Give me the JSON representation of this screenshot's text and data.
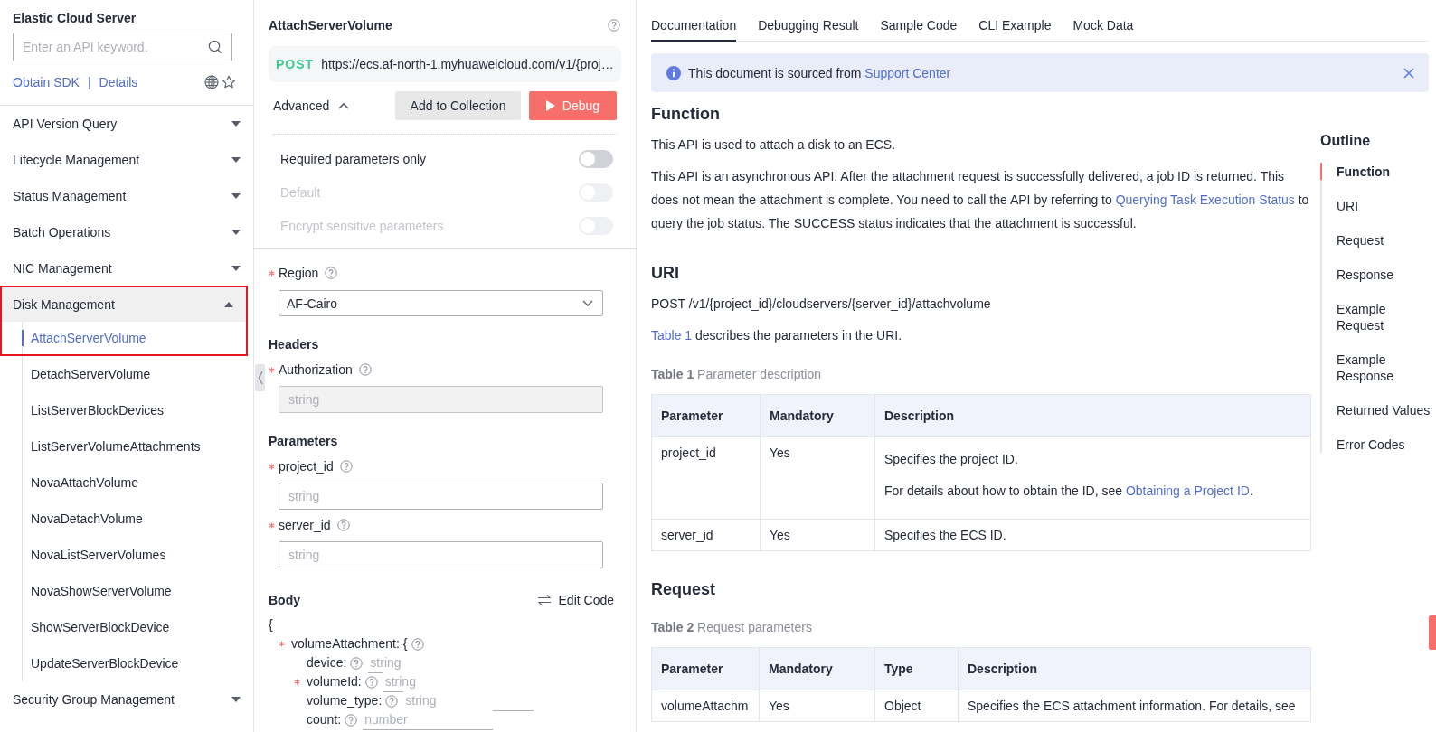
{
  "sidebar": {
    "title": "Elastic Cloud Server",
    "search": {
      "placeholder": "Enter an API keyword."
    },
    "links": [
      {
        "label": "Obtain SDK"
      },
      {
        "label": "Details"
      }
    ],
    "link_separator": "|",
    "groups": [
      {
        "label": "API Version Query",
        "expanded": false,
        "highlighted": false
      },
      {
        "label": "Lifecycle Management",
        "expanded": false,
        "highlighted": false
      },
      {
        "label": "Status Management",
        "expanded": false,
        "highlighted": false
      },
      {
        "label": "Batch Operations",
        "expanded": false,
        "highlighted": false
      },
      {
        "label": "NIC Management",
        "expanded": false,
        "highlighted": false
      },
      {
        "label": "Disk Management",
        "expanded": true,
        "highlighted": true,
        "children": [
          {
            "label": "AttachServerVolume",
            "selected": true
          },
          {
            "label": "DetachServerVolume",
            "selected": false
          },
          {
            "label": "ListServerBlockDevices",
            "selected": false
          },
          {
            "label": "ListServerVolumeAttachments",
            "selected": false
          },
          {
            "label": "NovaAttachVolume",
            "selected": false
          },
          {
            "label": "NovaDetachVolume",
            "selected": false
          },
          {
            "label": "NovaListServerVolumes",
            "selected": false
          },
          {
            "label": "NovaShowServerVolume",
            "selected": false
          },
          {
            "label": "ShowServerBlockDevice",
            "selected": false
          },
          {
            "label": "UpdateServerBlockDevice",
            "selected": false
          }
        ]
      },
      {
        "label": "Security Group Management",
        "expanded": false,
        "highlighted": false
      }
    ]
  },
  "debug_panel": {
    "title": "AttachServerVolume",
    "method": "POST",
    "url": "https://ecs.af-north-1.myhuaweicloud.com/v1/{proj…",
    "advanced": {
      "label": "Advanced",
      "expanded": true
    },
    "actions": [
      {
        "label": "Add to Collection",
        "kind": "secondary"
      },
      {
        "label": "Debug",
        "kind": "primary"
      }
    ],
    "toggles": [
      {
        "label": "Required parameters only",
        "on": false,
        "disabled": false
      },
      {
        "label": "Default",
        "on": false,
        "disabled": true
      },
      {
        "label": "Encrypt sensitive parameters",
        "on": false,
        "disabled": true
      }
    ],
    "region": {
      "label": "Region",
      "required": true,
      "value": "AF-Cairo"
    },
    "sections": [
      {
        "heading": "Headers",
        "fields": [
          {
            "label": "Authorization",
            "required": true,
            "placeholder": "string",
            "disabled": true
          }
        ]
      },
      {
        "heading": "Parameters",
        "fields": [
          {
            "label": "project_id",
            "required": true,
            "placeholder": "string",
            "disabled": false
          },
          {
            "label": "server_id",
            "required": true,
            "placeholder": "string",
            "disabled": false
          }
        ]
      }
    ],
    "body": {
      "heading": "Body",
      "edit_label": "Edit Code",
      "open_brace": "{",
      "object": {
        "key": "volumeAttachment:",
        "required": true,
        "brace": "{",
        "fields": [
          {
            "key": "device:",
            "required": false,
            "placeholder": "string"
          },
          {
            "key": "volumeId:",
            "required": true,
            "placeholder": "string"
          },
          {
            "key": "volume_type:",
            "required": false,
            "placeholder": "string"
          },
          {
            "key": "count:",
            "required": false,
            "placeholder": "number"
          }
        ]
      }
    }
  },
  "doc_panel": {
    "tabs": [
      {
        "label": "Documentation",
        "selected": true
      },
      {
        "label": "Debugging Result",
        "selected": false
      },
      {
        "label": "Sample Code",
        "selected": false
      },
      {
        "label": "CLI Example",
        "selected": false
      },
      {
        "label": "Mock Data",
        "selected": false
      }
    ],
    "banner": {
      "parts": [
        {
          "text": "This document is sourced from "
        },
        {
          "text": "Support Center",
          "link": true
        }
      ]
    },
    "blocks": [
      {
        "kind": "heading",
        "text": "Function"
      },
      {
        "kind": "paragraph",
        "parts": [
          {
            "text": "This API is used to attach a disk to an ECS."
          }
        ]
      },
      {
        "kind": "paragraph",
        "parts": [
          {
            "text": "This API is an asynchronous API. After the attachment request is successfully delivered, a job ID is returned. This does not mean the attachment is complete. You need to call the API by referring to "
          },
          {
            "text": "Querying Task Execution Status",
            "link": true
          },
          {
            "text": " to query the job status. The SUCCESS status indicates that the attachment is successful."
          }
        ]
      },
      {
        "kind": "heading",
        "text": "URI"
      },
      {
        "kind": "paragraph",
        "parts": [
          {
            "text": "POST /v1/{project_id}/cloudservers/{server_id}/attachvolume"
          }
        ]
      },
      {
        "kind": "paragraph",
        "parts": [
          {
            "text": "Table 1",
            "link": true
          },
          {
            "text": " describes the parameters in the URI."
          }
        ]
      },
      {
        "kind": "table",
        "caption": "**Table 1** Parameter description",
        "columns": [
          "Parameter",
          "Mandatory",
          "Description"
        ],
        "rows": [
          [
            "project_id",
            "Yes",
            [
              [
                {
                  "text": "Specifies the project ID."
                }
              ],
              [
                {
                  "text": "For details about how to obtain the ID, see "
                },
                {
                  "text": "Obtaining a Project ID",
                  "link": true
                },
                {
                  "text": "."
                }
              ]
            ]
          ],
          [
            "server_id",
            "Yes",
            "Specifies the ECS ID."
          ]
        ]
      },
      {
        "kind": "heading",
        "text": "Request"
      },
      {
        "kind": "table",
        "caption": "**Table 2** Request parameters",
        "columns": [
          "Parameter",
          "Mandatory",
          "Type",
          "Description"
        ],
        "rows": [
          [
            "volumeAttachm",
            "Yes",
            "Object",
            "Specifies the ECS attachment information. For details, see"
          ]
        ]
      }
    ]
  },
  "outline": {
    "title": "Outline",
    "items": [
      {
        "label": "Function",
        "selected": true
      },
      {
        "label": "URI",
        "selected": false
      },
      {
        "label": "Request",
        "selected": false
      },
      {
        "label": "Response",
        "selected": false
      },
      {
        "label": "Example Request",
        "selected": false
      },
      {
        "label": "Example Response",
        "selected": false
      },
      {
        "label": "Returned Values",
        "selected": false
      },
      {
        "label": "Error Codes",
        "selected": false
      }
    ]
  }
}
